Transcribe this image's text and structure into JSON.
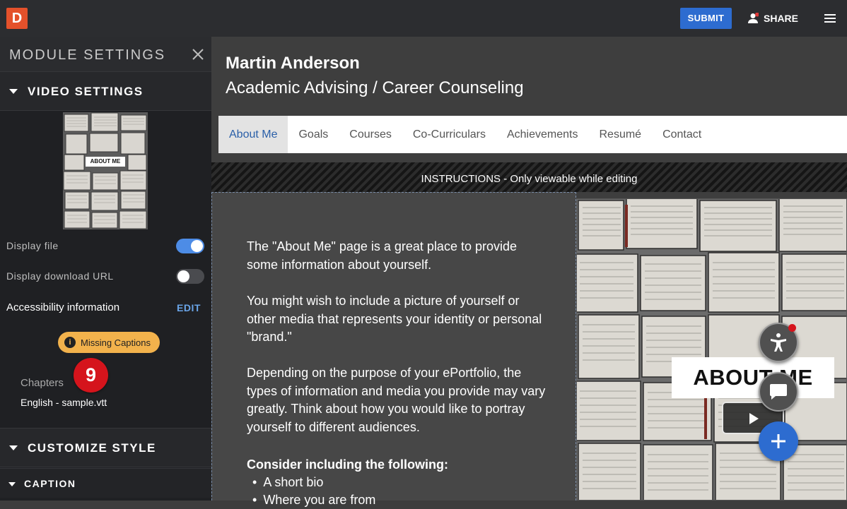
{
  "topbar": {
    "logo": "D",
    "submit_label": "SUBMIT",
    "share_label": "SHARE"
  },
  "sidebar": {
    "title": "MODULE SETTINGS",
    "video_settings_label": "VIDEO SETTINGS",
    "thumbnail_label": "ABOUT ME",
    "display_file_label": "Display file",
    "display_file_on": true,
    "display_download_label": "Display download URL",
    "display_download_on": false,
    "accessibility_label": "Accessibility information",
    "edit_label": "EDIT",
    "missing_captions_label": "Missing Captions",
    "chapters_label": "Chapters",
    "number_badge": "9",
    "vtt_file": "English - sample.vtt",
    "customize_style_label": "CUSTOMIZE STYLE",
    "caption_label": "CAPTION"
  },
  "main": {
    "name": "Martin Anderson",
    "subtitle": "Academic Advising / Career Counseling",
    "nav": [
      "About Me",
      "Goals",
      "Courses",
      "Co-Curriculars",
      "Achievements",
      "Resumé",
      "Contact"
    ],
    "active_nav": "About Me",
    "instructions": "INSTRUCTIONS - Only viewable while editing",
    "paragraphs": [
      "The \"About Me\" page is a great place to provide some information about yourself.",
      "You might wish to include a picture of yourself or other media that represents your identity or personal \"brand.\"",
      "Depending on the purpose of your ePortfolio, the types of information and media you provide may vary greatly. Think about how you would like to portray yourself to different audiences."
    ],
    "consider_heading": "Consider including the following:",
    "bullets": [
      "A short bio",
      "Where you are from"
    ],
    "photo_label": "ABOUT ME"
  },
  "colors": {
    "accent": "#2d6cd0",
    "logo": "#e4512b",
    "warning": "#f2b24c",
    "badge_red": "#d5141c"
  },
  "icons": [
    "user-icon",
    "notification-dot-icon",
    "menu-icon",
    "close-icon",
    "info-icon",
    "accessibility-icon",
    "chat-icon",
    "plus-icon",
    "play-icon",
    "caret-down-icon"
  ]
}
